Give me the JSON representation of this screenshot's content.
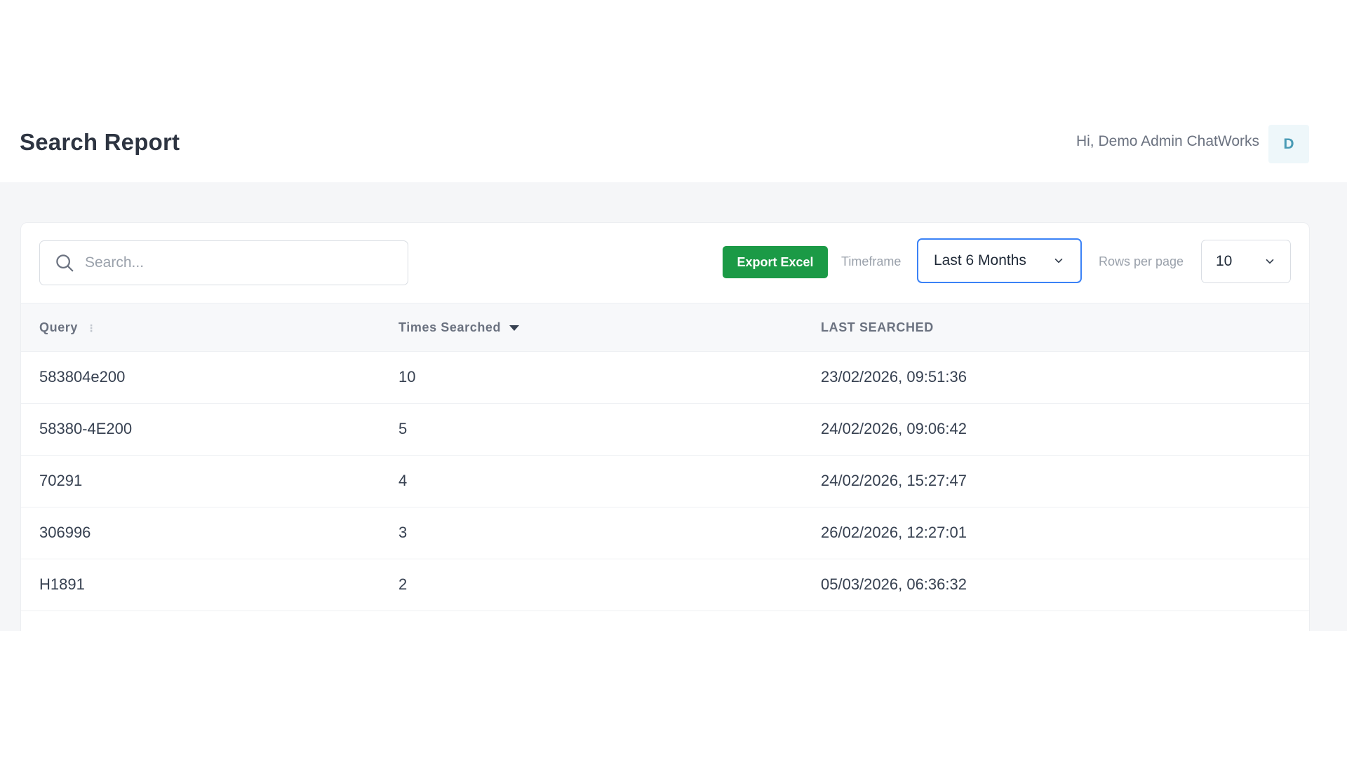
{
  "header": {
    "title": "Search Report",
    "greeting": "Hi, Demo Admin ChatWorks",
    "avatar_initial": "D"
  },
  "toolbar": {
    "search_placeholder": "Search...",
    "export_label": "Export Excel",
    "timeframe_label": "Timeframe",
    "timeframe_value": "Last 6 Months",
    "rows_per_page_label": "Rows per page",
    "rows_per_page_value": "10"
  },
  "table": {
    "columns": [
      "Query",
      "Times Searched",
      "LAST SEARCHED"
    ],
    "rows": [
      [
        "583804e200",
        "10",
        "23/02/2026, 09:51:36"
      ],
      [
        "58380-4E200",
        "5",
        "24/02/2026, 09:06:42"
      ],
      [
        "70291",
        "4",
        "24/02/2026, 15:27:47"
      ],
      [
        "306996",
        "3",
        "26/02/2026, 12:27:01"
      ],
      [
        "H1891",
        "2",
        "05/03/2026, 06:36:32"
      ]
    ]
  },
  "colors": {
    "export_button": "#1b9a46",
    "timeframe_focus_border": "#3b82f6",
    "content_background": "#f5f6f8"
  }
}
